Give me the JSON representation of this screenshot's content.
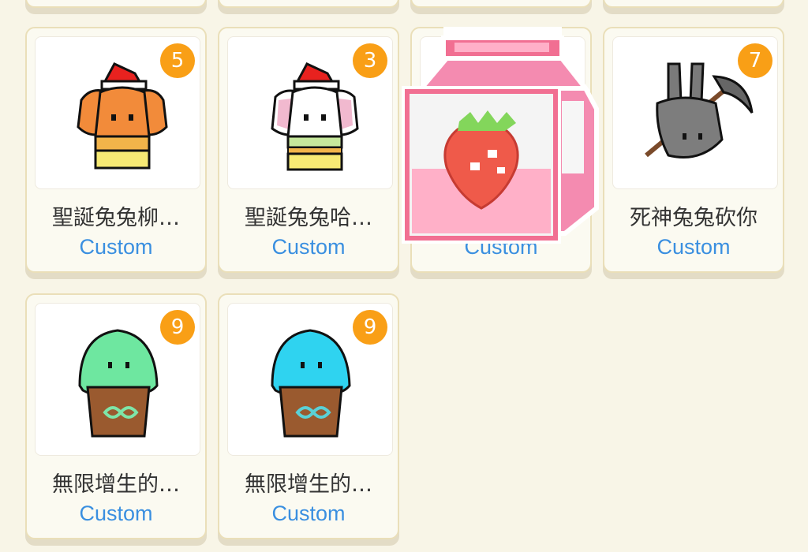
{
  "colors": {
    "page_bg": "#f8f5e7",
    "card_bg": "#fbfaf1",
    "badge": "#f99f16",
    "title_text": "#333333",
    "type_text": "#3a8fe0"
  },
  "cards": [
    {
      "title": "聖誕兔兔柳…",
      "type": "Custom",
      "badge": "5",
      "icon": "christmas-bunny-orange"
    },
    {
      "title": "聖誕兔兔哈…",
      "type": "Custom",
      "badge": "3",
      "icon": "christmas-bunny-white"
    },
    {
      "title": "",
      "type": "Custom",
      "badge": "",
      "icon": "strawberry-milk-carton"
    },
    {
      "title": "死神兔兔砍你",
      "type": "Custom",
      "badge": "7",
      "icon": "grim-reaper-bunny"
    },
    {
      "title": "無限增生的…",
      "type": "Custom",
      "badge": "9",
      "icon": "infinite-bunny-green"
    },
    {
      "title": "無限增生的…",
      "type": "Custom",
      "badge": "9",
      "icon": "infinite-bunny-cyan"
    }
  ]
}
